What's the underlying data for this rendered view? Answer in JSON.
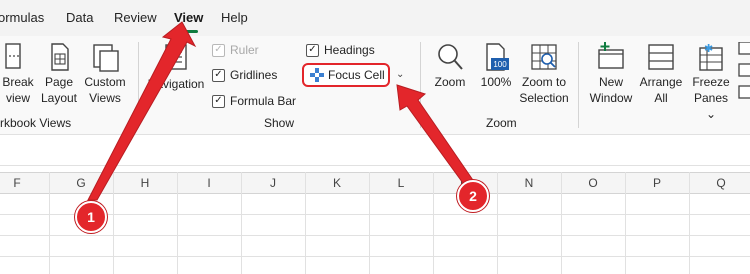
{
  "menubar": {
    "items": [
      "ormulas",
      "Data",
      "Review",
      "View",
      "Help"
    ],
    "active": "View"
  },
  "workbook_views": {
    "page_break": [
      "Break",
      "view"
    ],
    "page_layout": [
      "Page",
      "Layout"
    ],
    "custom_views": [
      "Custom",
      "Views"
    ],
    "group_label": "rkbook Views"
  },
  "show": {
    "navigation": "Navigation",
    "ruler": "Ruler",
    "gridlines": "Gridlines",
    "formula_bar": "Formula Bar",
    "headings": "Headings",
    "focus_cell": "Focus Cell",
    "group_label": "Show"
  },
  "zoom": {
    "zoom": "Zoom",
    "zoom_100": "100%",
    "zoom_to_selection": [
      "Zoom to",
      "Selection"
    ],
    "group_label": "Zoom",
    "badge_100": "100"
  },
  "window": {
    "new_window": [
      "New",
      "Window"
    ],
    "arrange_all": [
      "Arrange",
      "All"
    ],
    "freeze_panes": [
      "Freeze",
      "Panes"
    ]
  },
  "columns": [
    "F",
    "G",
    "H",
    "I",
    "J",
    "K",
    "L",
    "M",
    "N",
    "O",
    "P",
    "Q"
  ],
  "annotations": {
    "badge1": "1",
    "badge2": "2",
    "color": "#e3262b"
  }
}
